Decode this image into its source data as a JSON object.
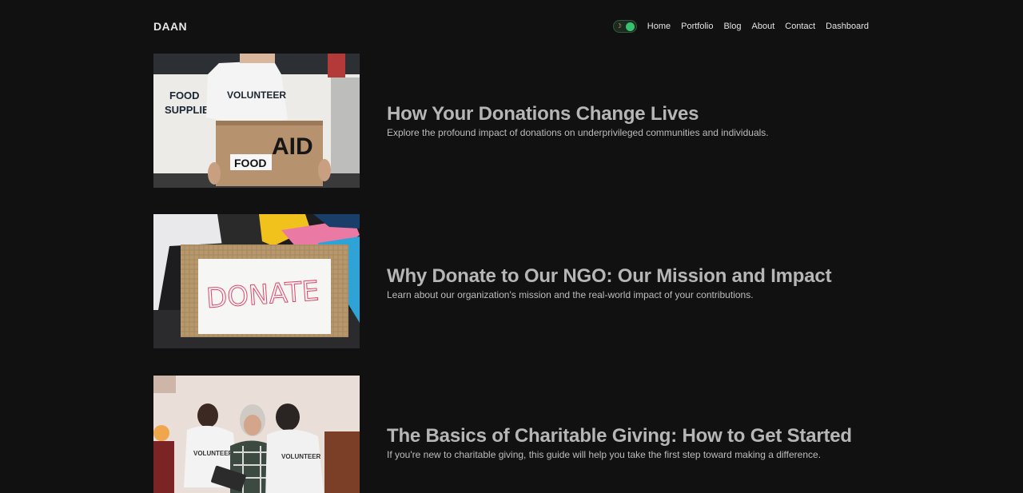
{
  "brand": "DAAN",
  "theme_toggle": {
    "icon": "moon-icon",
    "state": "dark",
    "accent": "#35c36d"
  },
  "nav": {
    "items": [
      {
        "label": "Home"
      },
      {
        "label": "Portfolio"
      },
      {
        "label": "Blog"
      },
      {
        "label": "About"
      },
      {
        "label": "Contact"
      },
      {
        "label": "Dashboard"
      }
    ]
  },
  "posts": [
    {
      "title": "How Your Donations Change Lives",
      "excerpt": "Explore the profound impact of donations on underprivileged communities and individuals.",
      "image_text": {
        "van_text_1": "FOOD",
        "van_text_2": "SUPPLIES",
        "shirt_text": "VOLUNTEER",
        "box_text_1": "AID",
        "box_text_2": "FOOD"
      }
    },
    {
      "title": "Why Donate to Our NGO: Our Mission and Impact",
      "excerpt": "Learn about our organization's mission and the real-world impact of your contributions.",
      "image_text": {
        "sign_text": "DONATE"
      }
    },
    {
      "title": "The Basics of Charitable Giving: How to Get Started",
      "excerpt": "If you're new to charitable giving, this guide will help you take the first step toward making a difference.",
      "image_text": {
        "shirt_text_1": "VOLUNTEER",
        "shirt_text_2": "VOLUNTEER"
      }
    }
  ],
  "colors": {
    "background": "#121112",
    "title": "#b6b6b6",
    "excerpt": "#bdbdbd",
    "nav": "#e4e4e4"
  }
}
